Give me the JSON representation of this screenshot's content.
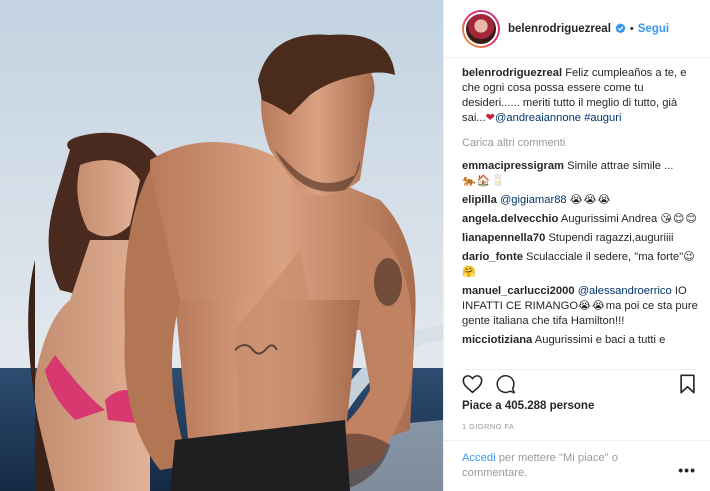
{
  "post": {
    "username": "belenrodriguezreal",
    "verified": true,
    "separator": "•",
    "follow_label": "Segui",
    "caption": {
      "username": "belenrodriguezreal",
      "text": "Feliz cumpleaños a te, e che ogni cosa possa essere come tu desideri...... meriti tutto il meglio di tutto, già sai...",
      "emoji": "❤",
      "mention": "@andreaiannone",
      "hashtag": "#auguri"
    },
    "load_more_label": "Carica altri commenti",
    "comments": [
      {
        "username": "emmacipressigram",
        "text": "Simile attrae simile ...",
        "emoji": "🐅🏠🥛"
      },
      {
        "username": "elipilla",
        "mention": "@gigiamar88",
        "text": "",
        "emoji": "😭😭😭"
      },
      {
        "username": "angela.delvecchio",
        "text": "Augurissimi Andrea",
        "emoji": "😘😊😊"
      },
      {
        "username": "lianapennella70",
        "text": "Stupendi ragazzi,auguriiii",
        "emoji": ""
      },
      {
        "username": "dario_fonte",
        "text": "Sculacciale il sedere, \"ma forte\"",
        "emoji": "😉🤗"
      },
      {
        "username": "manuel_carlucci2000",
        "mention": "@alessandroerrico",
        "text": "IO INFATTI CE RIMANGO",
        "emoji": "😭😭",
        "text2": "ma poi ce sta pure gente italiana che tifa Hamilton!!!"
      },
      {
        "username": "micciotiziana",
        "text": "Augurissimi e baci a tutti e",
        "emoji": ""
      }
    ],
    "actions": {
      "like_icon": "heart-icon",
      "comment_icon": "comment-icon",
      "save_icon": "bookmark-icon"
    },
    "likes_text": "Piace a 405.288 persone",
    "date_text": "1 GIORNO FA",
    "add_comment": {
      "login_link": "Accedi",
      "rest": "per mettere \"Mi piace\" o commentare."
    },
    "options_icon": "more-options-icon",
    "options_label": "•••"
  },
  "colors": {
    "accent": "#3897f0",
    "text": "#262626",
    "muted": "#999999",
    "link": "#003569",
    "sky": "#c9d7e3",
    "sea": "#1f3a5b"
  }
}
